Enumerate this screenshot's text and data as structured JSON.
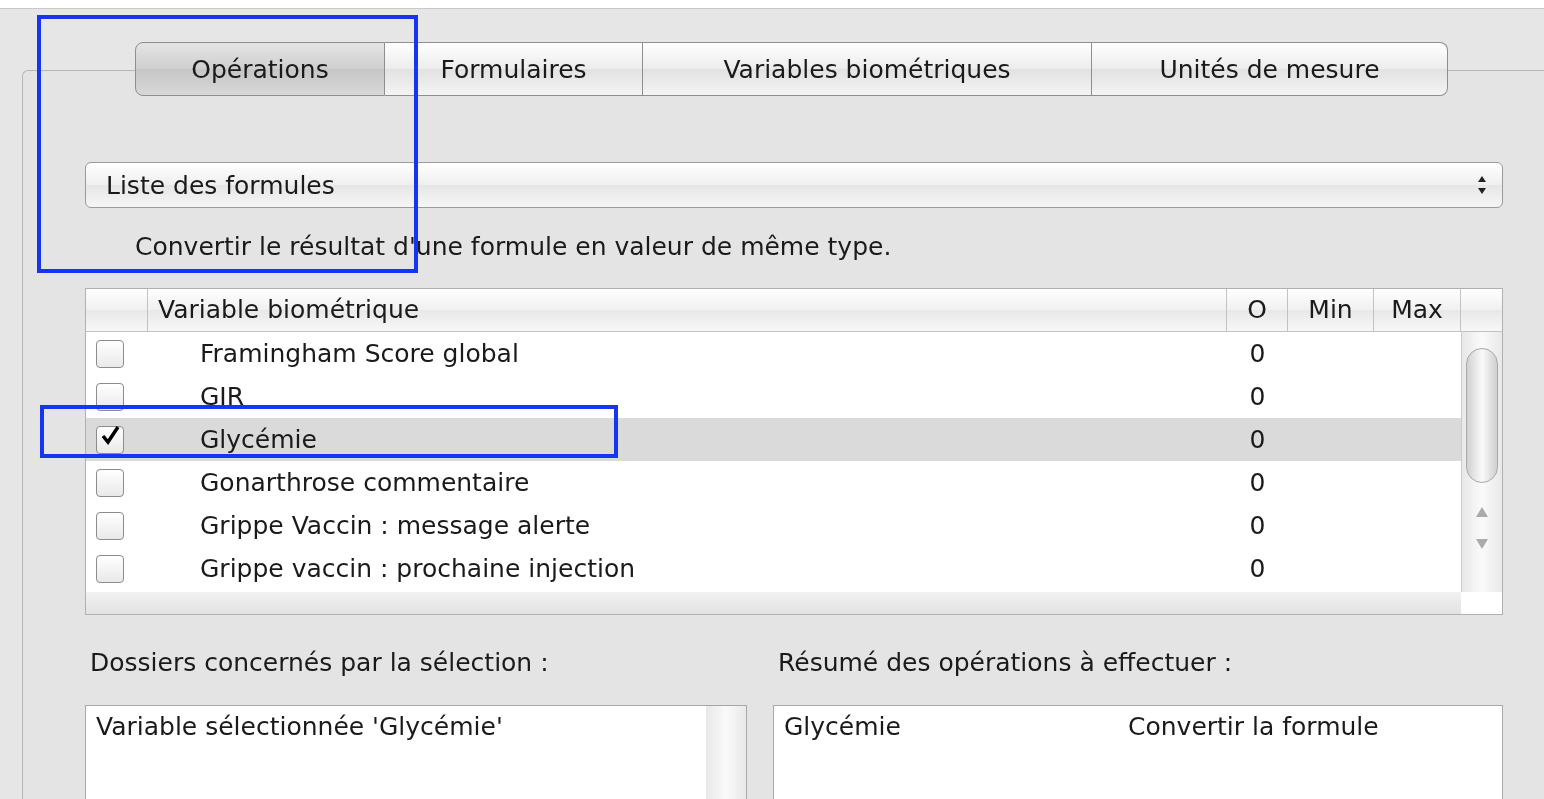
{
  "tabs": [
    {
      "label": "Opérations",
      "selected": true
    },
    {
      "label": "Formulaires",
      "selected": false
    },
    {
      "label": "Variables biométriques",
      "selected": false
    },
    {
      "label": "Unités de mesure",
      "selected": false
    }
  ],
  "dropdown": {
    "value": "Liste des formules"
  },
  "description": "Convertir le résultat d'une formule en valeur de même type.",
  "table": {
    "columns": [
      "Variable biométrique",
      "O",
      "Min",
      "Max"
    ],
    "rows": [
      {
        "checked": false,
        "selected": false,
        "name": "Framingham Score global",
        "o": "0"
      },
      {
        "checked": false,
        "selected": false,
        "name": "GIR",
        "o": "0"
      },
      {
        "checked": true,
        "selected": true,
        "name": "Glycémie",
        "o": "0"
      },
      {
        "checked": false,
        "selected": false,
        "name": "Gonarthrose commentaire",
        "o": "0"
      },
      {
        "checked": false,
        "selected": false,
        "name": "Grippe Vaccin : message alerte",
        "o": "0"
      },
      {
        "checked": false,
        "selected": false,
        "name": "Grippe vaccin : prochaine injection",
        "o": "0"
      }
    ]
  },
  "left_panel": {
    "label": "Dossiers concernés par la sélection :",
    "lines": [
      "Variable sélectionnée 'Glycémie'"
    ]
  },
  "right_panel": {
    "label": "Résumé des opérations à effectuer :",
    "rows": [
      {
        "item": "Glycémie",
        "operation": "Convertir la formule"
      }
    ]
  }
}
